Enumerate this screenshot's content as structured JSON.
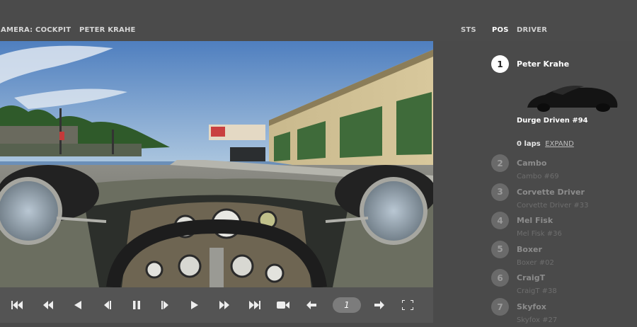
{
  "header": {
    "camera_label": "AMERA: COCKPIT",
    "driver_label": "PETER KRAHE",
    "columns": {
      "sts": "STS",
      "pos": "POS",
      "driver": "DRIVER"
    }
  },
  "controls": {
    "buttons": [
      "skip-to-start",
      "rewind",
      "step-back",
      "frame-back",
      "pause",
      "frame-forward",
      "play",
      "fast-forward",
      "skip-to-end",
      "camera",
      "previous",
      "next",
      "fullscreen"
    ],
    "lap_value": "1"
  },
  "standings": {
    "leader": {
      "position": "1",
      "name": "Peter Krahe",
      "car": "Durge Driven #94",
      "laps": "0 laps",
      "expand_label": "EXPAND"
    },
    "others": [
      {
        "position": "2",
        "name": "Cambo",
        "car": "Cambo #69"
      },
      {
        "position": "3",
        "name": "Corvette Driver",
        "car": "Corvette Driver #33"
      },
      {
        "position": "4",
        "name": "Mel Fisk",
        "car": "Mel Fisk #36"
      },
      {
        "position": "5",
        "name": "Boxer",
        "car": "Boxer #02"
      },
      {
        "position": "6",
        "name": "CraigT",
        "car": "CraigT #38"
      },
      {
        "position": "7",
        "name": "Skyfox",
        "car": "Skyfox #27"
      }
    ]
  },
  "colors": {
    "background": "#4a4a4a",
    "leader_circle": "#ffffff",
    "muted_circle": "#6a6a6a",
    "muted_text": "#8c8c8c"
  }
}
